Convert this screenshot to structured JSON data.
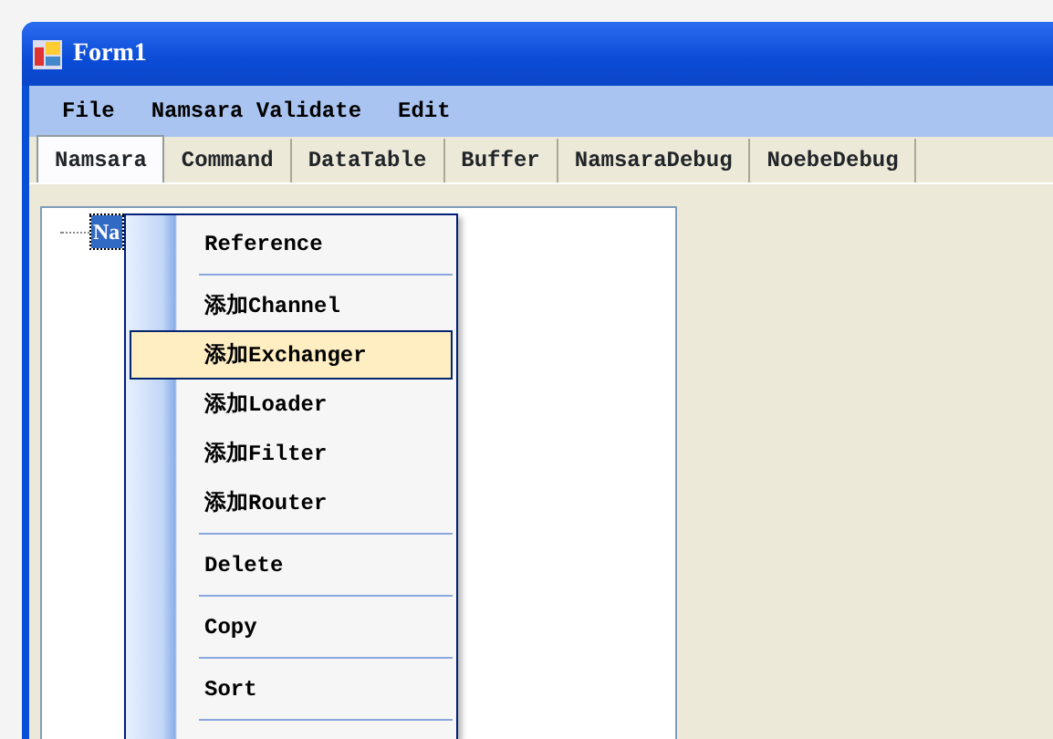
{
  "window": {
    "title": "Form1"
  },
  "menu_bar": [
    "File",
    "Namsara Validate",
    "Edit"
  ],
  "tabs": [
    {
      "label": "Namsara",
      "selected": true
    },
    {
      "label": "Command",
      "selected": false
    },
    {
      "label": "DataTable",
      "selected": false
    },
    {
      "label": "Buffer",
      "selected": false
    },
    {
      "label": "NamsaraDebug",
      "selected": false
    },
    {
      "label": "NoebeDebug",
      "selected": false
    }
  ],
  "tree": {
    "nodes": [
      {
        "label": "Na",
        "selected": true
      }
    ]
  },
  "context_menu": [
    {
      "kind": "item",
      "label": "Reference",
      "selected": false
    },
    {
      "kind": "separator"
    },
    {
      "kind": "item",
      "label": "添加Channel",
      "selected": false
    },
    {
      "kind": "item",
      "label": "添加Exchanger",
      "selected": true
    },
    {
      "kind": "item",
      "label": "添加Loader",
      "selected": false
    },
    {
      "kind": "item",
      "label": "添加Filter",
      "selected": false
    },
    {
      "kind": "item",
      "label": "添加Router",
      "selected": false
    },
    {
      "kind": "separator"
    },
    {
      "kind": "item",
      "label": "Delete",
      "selected": false
    },
    {
      "kind": "separator"
    },
    {
      "kind": "item",
      "label": "Copy",
      "selected": false
    },
    {
      "kind": "separator"
    },
    {
      "kind": "item",
      "label": "Sort",
      "selected": false
    },
    {
      "kind": "separator"
    }
  ]
}
